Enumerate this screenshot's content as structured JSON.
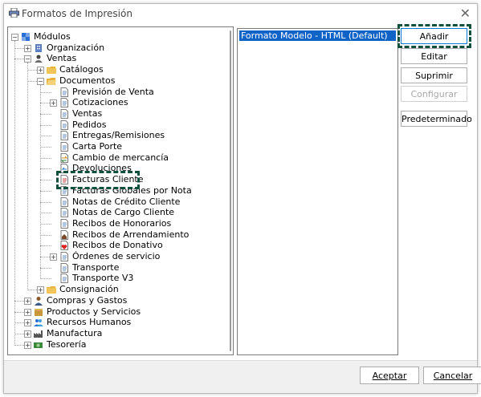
{
  "window": {
    "title": "Formatos de Impresión",
    "close_glyph": "✕"
  },
  "tree": {
    "nodes": [
      {
        "label": "Módulos",
        "icon": "modules-icon",
        "level": 0,
        "expander": "−"
      },
      {
        "label": "Organización",
        "icon": "building-icon",
        "level": 1,
        "expander": "+"
      },
      {
        "label": "Ventas",
        "icon": "users-icon",
        "level": 1,
        "expander": "−"
      },
      {
        "label": "Catálogos",
        "icon": "folder-icon",
        "level": 2,
        "expander": "+"
      },
      {
        "label": "Documentos",
        "icon": "folder-open-icon",
        "level": 2,
        "expander": "−"
      },
      {
        "label": "Previsión de Venta",
        "icon": "document-icon",
        "level": 3,
        "expander": ""
      },
      {
        "label": "Cotizaciones",
        "icon": "document-icon",
        "level": 3,
        "expander": "+"
      },
      {
        "label": "Ventas",
        "icon": "document-icon",
        "level": 3,
        "expander": ""
      },
      {
        "label": "Pedidos",
        "icon": "document-icon",
        "level": 3,
        "expander": ""
      },
      {
        "label": "Entregas/Remisiones",
        "icon": "document-icon",
        "level": 3,
        "expander": ""
      },
      {
        "label": "Carta Porte",
        "icon": "document-icon",
        "level": 3,
        "expander": ""
      },
      {
        "label": "Cambio de mercancía",
        "icon": "exchange-icon",
        "level": 3,
        "expander": ""
      },
      {
        "label": "Devoluciones",
        "icon": "return-icon",
        "level": 3,
        "expander": ""
      },
      {
        "label": "Facturas Cliente",
        "icon": "invoice-icon",
        "level": 3,
        "expander": ""
      },
      {
        "label": "Facturas Globales por Nota",
        "icon": "document-icon",
        "level": 3,
        "expander": ""
      },
      {
        "label": "Notas de Crédito Cliente",
        "icon": "document-icon",
        "level": 3,
        "expander": ""
      },
      {
        "label": "Notas de Cargo Cliente",
        "icon": "document-icon",
        "level": 3,
        "expander": ""
      },
      {
        "label": "Recibos de Honorarios",
        "icon": "document-icon",
        "level": 3,
        "expander": ""
      },
      {
        "label": "Recibos de Arrendamiento",
        "icon": "house-icon",
        "level": 3,
        "expander": ""
      },
      {
        "label": "Recibos de Donativo",
        "icon": "heart-icon",
        "level": 3,
        "expander": ""
      },
      {
        "label": "Órdenes de servicio",
        "icon": "document-icon",
        "level": 3,
        "expander": "+"
      },
      {
        "label": "Transporte",
        "icon": "document-icon",
        "level": 3,
        "expander": ""
      },
      {
        "label": "Transporte V3",
        "icon": "document-icon",
        "level": 3,
        "expander": ""
      },
      {
        "label": "Consignación",
        "icon": "folder-icon",
        "level": 2,
        "expander": "+"
      },
      {
        "label": "Compras y Gastos",
        "icon": "person-icon",
        "level": 1,
        "expander": "+"
      },
      {
        "label": "Productos y Servicios",
        "icon": "box-icon",
        "level": 1,
        "expander": "+"
      },
      {
        "label": "Recursos Humanos",
        "icon": "people-icon",
        "level": 1,
        "expander": "+"
      },
      {
        "label": "Manufactura",
        "icon": "factory-icon",
        "level": 1,
        "expander": "+"
      },
      {
        "label": "Tesorería",
        "icon": "money-icon",
        "level": 1,
        "expander": "+"
      }
    ]
  },
  "formats": {
    "items": [
      "Formato Modelo - HTML (Default)"
    ]
  },
  "buttons": {
    "add": "Añadir",
    "edit": "Editar",
    "delete": "Suprimir",
    "configure": "Configurar",
    "default": "Predeterminado"
  },
  "footer": {
    "accept": "Aceptar",
    "cancel": "Cancelar"
  },
  "colors": {
    "selection": "#0f63c7",
    "highlight_dash": "#0e4f3e",
    "folder": "#e8b23a"
  }
}
